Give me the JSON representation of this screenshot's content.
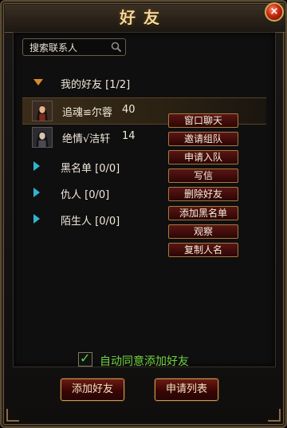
{
  "window": {
    "title": "好友",
    "close_glyph": "×"
  },
  "search": {
    "placeholder": "搜索联系人",
    "icon": "search-icon"
  },
  "groups": {
    "my_friends": {
      "label": "我的好友 [1/2]"
    },
    "blacklist": {
      "label": "黑名单 [0/0]"
    },
    "enemies": {
      "label": "仇人 [0/0]"
    },
    "strangers": {
      "label": "陌生人 [0/0]"
    }
  },
  "friends": [
    {
      "name": "追魂≌尔蓉",
      "level": "40"
    },
    {
      "name": "绝情√洁轩",
      "level": "14"
    }
  ],
  "context_menu": {
    "items": [
      "窗口聊天",
      "邀请组队",
      "申请入队",
      "写信",
      "删除好友",
      "添加黑名单",
      "观察",
      "复制人名"
    ]
  },
  "auto_accept": {
    "label": "自动同意添加好友",
    "checked": true
  },
  "buttons": {
    "add_friend": "添加好友",
    "request_list": "申请列表"
  },
  "colors": {
    "accent_gold": "#f1d79a",
    "green_label": "#6fd23c",
    "menu_red": "#5a1515",
    "expand_orange": "#d78b2e",
    "collapse_cyan": "#2fb6d1"
  }
}
